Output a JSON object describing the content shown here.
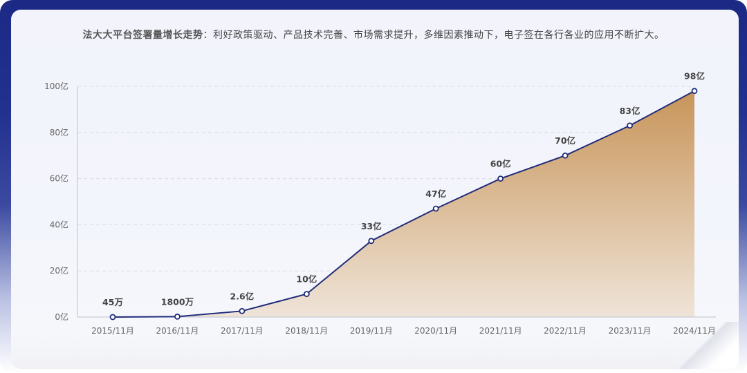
{
  "headline": {
    "lead": "法大大平台签署量增长走势",
    "separator": "：",
    "rest": "利好政策驱动、产品技术完善、市场需求提升，多维因素推动下，电子签在各行各业的应用不断扩大。"
  },
  "colors": {
    "frame": "#1c2a86",
    "line": "#1f2b7a",
    "area_top": "#c8955a",
    "area_bottom": "#efe4d8",
    "grid": "#d9dbe3"
  },
  "chart_data": {
    "type": "area",
    "x": [
      "2015/11月",
      "2016/11月",
      "2017/11月",
      "2018/11月",
      "2019/11月",
      "2020/11月",
      "2021/11月",
      "2022/11月",
      "2023/11月",
      "2024/11月"
    ],
    "values": [
      0.0045,
      0.18,
      2.6,
      10,
      33,
      47,
      60,
      70,
      83,
      98
    ],
    "data_labels": [
      "45万",
      "1800万",
      "2.6亿",
      "10亿",
      "33亿",
      "47亿",
      "60亿",
      "70亿",
      "83亿",
      "98亿"
    ],
    "yticks": [
      0,
      20,
      40,
      60,
      80,
      100
    ],
    "ytick_labels": [
      "0亿",
      "20亿",
      "40亿",
      "60亿",
      "80亿",
      "100亿"
    ],
    "ylim": [
      0,
      100
    ],
    "grid": true,
    "legend": "none"
  }
}
